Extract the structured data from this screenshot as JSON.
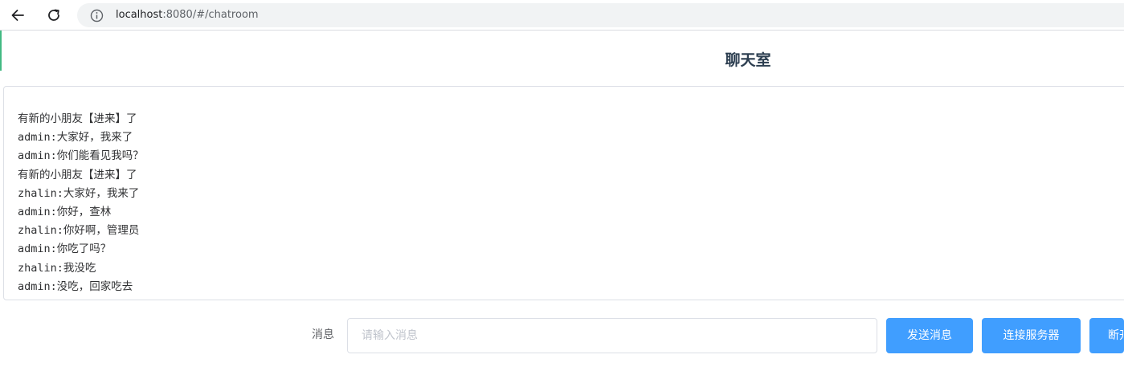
{
  "browser": {
    "url_host": "localhost",
    "url_path": ":8080/#/chatroom",
    "icons": {
      "back": "arrow-left-icon",
      "reload": "reload-icon",
      "info": "info-circle-icon"
    }
  },
  "page": {
    "title": "聊天室"
  },
  "messages": [
    "有新的小朋友【进来】了",
    "admin:大家好，我来了",
    "admin:你们能看见我吗？",
    "有新的小朋友【进来】了",
    "zhalin:大家好，我来了",
    "admin:你好，查林",
    "zhalin:你好啊，管理员",
    "admin:你吃了吗？",
    "zhalin:我没吃",
    "admin:没吃，回家吃去"
  ],
  "form": {
    "label": "消息",
    "input_value": "",
    "input_placeholder": "请输入消息",
    "send_label": "发送消息",
    "connect_label": "连接服务器",
    "disconnect_label": "断开"
  },
  "colors": {
    "primary": "#409eff",
    "title": "#2c3e50",
    "accent_strip": "#42b983"
  }
}
